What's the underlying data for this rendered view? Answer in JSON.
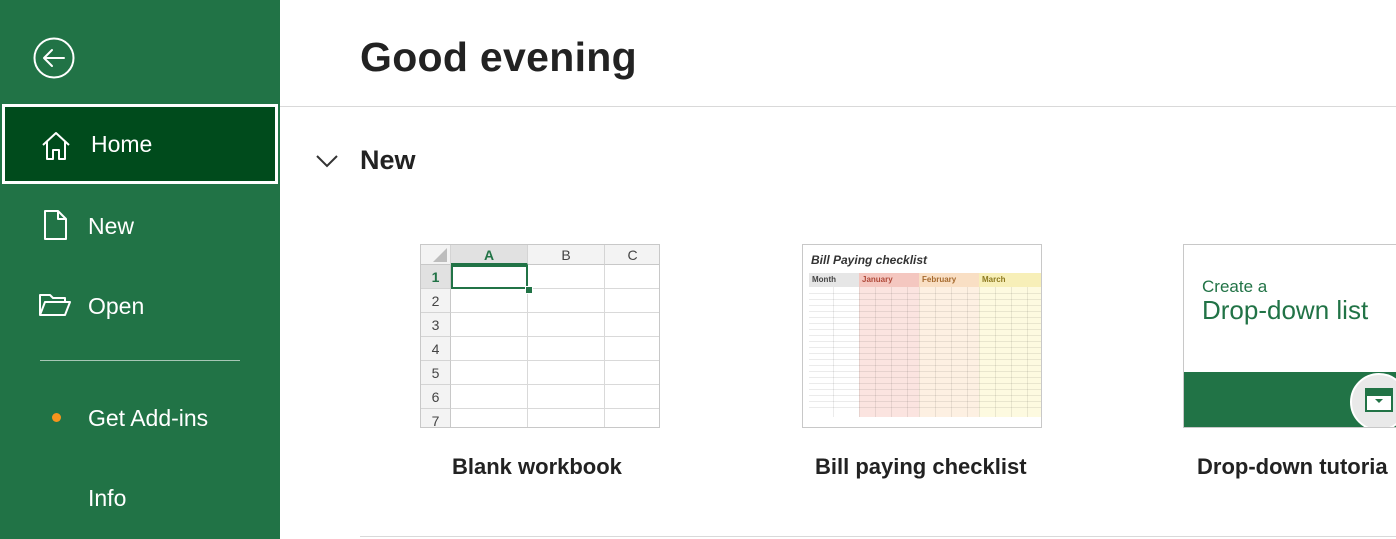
{
  "sidebar": {
    "back_icon": "back-arrow-icon",
    "items": [
      {
        "label": "Home",
        "icon": "home-icon",
        "active": true
      },
      {
        "label": "New",
        "icon": "new-document-icon"
      },
      {
        "label": "Open",
        "icon": "folder-open-icon"
      },
      {
        "label": "Get Add-ins",
        "icon": "addin-dot-icon"
      },
      {
        "label": "Info"
      }
    ]
  },
  "main": {
    "greeting": "Good evening",
    "section_title": "New",
    "templates": [
      {
        "label": "Blank workbook",
        "columns": [
          "A",
          "B",
          "C"
        ],
        "rows": [
          "1",
          "2",
          "3",
          "4",
          "5",
          "6",
          "7"
        ]
      },
      {
        "label": "Bill paying checklist",
        "thumb_title": "Bill Paying checklist",
        "months": [
          "Month",
          "January",
          "February",
          "March"
        ]
      },
      {
        "label": "Drop-down tutoria",
        "thumb_sub": "Create a",
        "thumb_title": "Drop-down list"
      }
    ]
  },
  "colors": {
    "accent": "#217346",
    "active_nav": "#004b1c",
    "addin_dot": "#f7941d"
  }
}
